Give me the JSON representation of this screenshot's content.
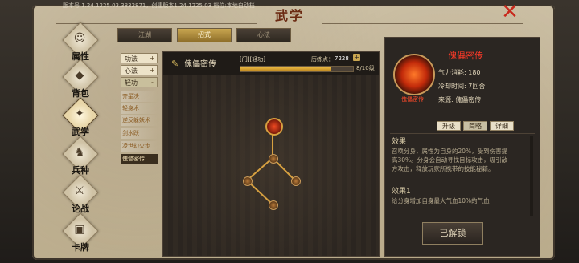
{
  "app": {
    "version": "版本号 1.24.1225.03.3832871，创建版本1.24.1225.03 档位:本地自动档",
    "title": "武学"
  },
  "nav": [
    {
      "label": "属性",
      "icon": "head-icon"
    },
    {
      "label": "背包",
      "icon": "bag-icon"
    },
    {
      "label": "武学",
      "icon": "martial-icon"
    },
    {
      "label": "兵种",
      "icon": "soldier-icon"
    },
    {
      "label": "论战",
      "icon": "battle-icon"
    },
    {
      "label": "卡牌",
      "icon": "card-icon"
    }
  ],
  "tabs": [
    "江湖",
    "招式",
    "心法"
  ],
  "categories": [
    {
      "label": "功法",
      "toggle": "+"
    },
    {
      "label": "心法",
      "toggle": "+"
    },
    {
      "label": "轻功",
      "toggle": "-"
    }
  ],
  "skills": [
    "齐星决",
    "轻身术",
    "逆反躲妖术",
    "剑水跃",
    "凌世幻火步",
    "傀儡密传"
  ],
  "center": {
    "name": "傀儡密传",
    "tags": "[门][轻功]",
    "exp_label": "历练点：",
    "exp_value": "7228",
    "progress": 0.8,
    "count": "8/10级"
  },
  "detail": {
    "name": "傀儡密传",
    "portrait_label": "傀儡密传",
    "qi": "气力消耗: 180",
    "cooldown": "冷却时间: 7回合",
    "source": "来源: 傀儡密传",
    "btn_upgrade": "升级",
    "btn_simple": "简略",
    "btn_detail": "详细",
    "effect_title": "效果",
    "effect_text": "召唤分身，属性为自身的20%，受到伤害提高30%。分身会自动寻找目标攻击，吸引敌方攻击，释放玩家所携带的技能秘籍。",
    "effect1_title": "效果1",
    "effect1_text": "给分身增加自身最大气血10%的气血",
    "unlock_label": "已解锁"
  },
  "colors": {
    "accent": "#c9a650",
    "title": "#6b2a12",
    "close": "#c8281c",
    "skill_name": "#ff3a28"
  }
}
